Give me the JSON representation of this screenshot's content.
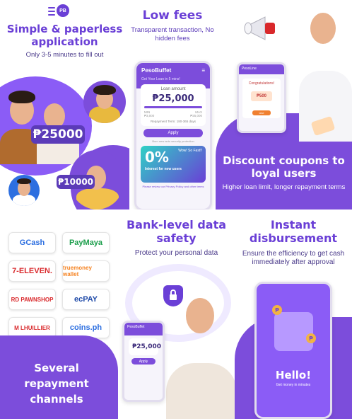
{
  "panel1": {
    "logo_text": "PB",
    "headline": "Simple & paperless application",
    "subline": "Only 3-5 minutes to fill out",
    "amount_large": "₱25000",
    "amount_small": "₱10000"
  },
  "panel2": {
    "headline": "Low fees",
    "subline": "Transparent transaction, No hidden fees",
    "app": {
      "brand": "PesoBuffet",
      "menu_icon": "≡",
      "hint": "Get Your Loan in 5 mins!",
      "loan_label": "Loan amount",
      "loan_value": "₱25,000",
      "min_label": "MIN",
      "min_value": "₱3,000",
      "max_label": "MAX",
      "max_value": "₱25,000",
      "term": "Repayment Term: 180-365 days",
      "apply": "Apply",
      "protect": "Born new auto security protection",
      "promo_value": "0%",
      "promo_text": "Interest for new users",
      "promo_wow": "Wow! So Fast!!",
      "fine_print": "Please review our Privacy Policy and other terms"
    }
  },
  "panel3": {
    "headline": "Discount coupons to loyal users",
    "subline": "Higher loan limit, longer repayment terms",
    "app": {
      "brand": "PesoLine",
      "dialog_title": "Congratulations!",
      "dialog_value": "₱500",
      "dialog_btn": "Use"
    }
  },
  "panel4": {
    "headline": "Several repayment channels",
    "wallets": [
      {
        "label": "GCash",
        "color": "#2d6fe0"
      },
      {
        "label": "PayMaya",
        "color": "#1b9e4b"
      },
      {
        "label": "7-ELEVEN.",
        "color": "#d9282b"
      },
      {
        "label": "truemoney wallet",
        "color": "#f58220"
      },
      {
        "label": "RD PAWNSHOP",
        "color": "#d9282b"
      },
      {
        "label": "ecPAY",
        "color": "#1f4aa8"
      },
      {
        "label": "M LHUILLIER",
        "color": "#d9282b"
      },
      {
        "label": "coins.ph",
        "color": "#2d6fe0"
      }
    ]
  },
  "panel5": {
    "headline": "Bank-level data safety",
    "subline": "Protect your personal data",
    "app": {
      "brand": "PesoBuffet",
      "loan_value": "₱25,000",
      "apply": "Apply"
    }
  },
  "panel6": {
    "headline": "Instant disbursement",
    "subline": "Ensure the efficiency to get cash immediately after approval",
    "hello": "Hello!",
    "tagline": "Get money in minutes",
    "coin_symbol": "₱"
  },
  "colors": {
    "brand_purple": "#7c4ddb",
    "headline_purple": "#6a3fd6"
  }
}
